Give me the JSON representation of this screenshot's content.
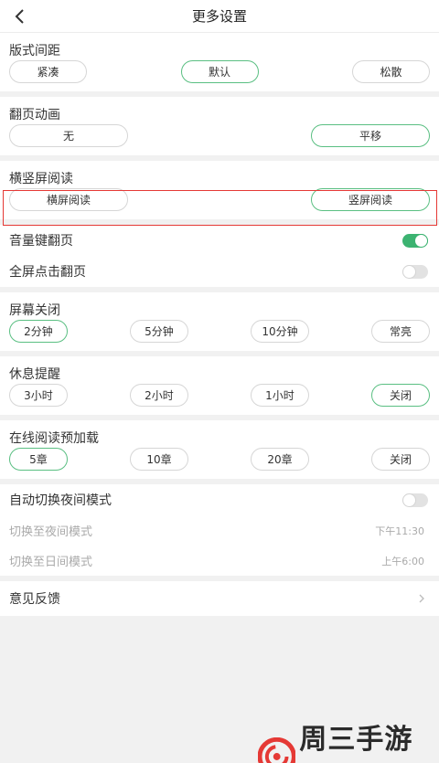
{
  "header": {
    "title": "更多设置",
    "back_icon": "back-arrow-icon"
  },
  "layout_spacing": {
    "title": "版式间距",
    "options": [
      "紧凑",
      "默认",
      "松散"
    ],
    "selected": "默认"
  },
  "page_animation": {
    "title": "翻页动画",
    "options": [
      "无",
      "平移"
    ],
    "selected": "平移"
  },
  "orientation": {
    "title": "横竖屏阅读",
    "options": [
      "横屏阅读",
      "竖屏阅读"
    ],
    "selected": "竖屏阅读"
  },
  "volume_key": {
    "label": "音量键翻页",
    "on": true
  },
  "fullscreen_tap": {
    "label": "全屏点击翻页",
    "on": false
  },
  "screen_off": {
    "title": "屏幕关闭",
    "options": [
      "2分钟",
      "5分钟",
      "10分钟",
      "常亮"
    ],
    "selected": "2分钟"
  },
  "rest_reminder": {
    "title": "休息提醒",
    "options": [
      "3小时",
      "2小时",
      "1小时",
      "关闭"
    ],
    "selected": "关闭"
  },
  "preload": {
    "title": "在线阅读预加载",
    "options": [
      "5章",
      "10章",
      "20章",
      "关闭"
    ],
    "selected": "5章"
  },
  "night_mode": {
    "label": "自动切换夜间模式",
    "on": false,
    "to_night_label": "切换至夜间模式",
    "to_night_time": "下午11:30",
    "to_day_label": "切换至日间模式",
    "to_day_time": "上午6:00"
  },
  "feedback": {
    "label": "意见反馈"
  },
  "watermark": {
    "text": "周三手游网"
  },
  "colors": {
    "accent": "#3cb371",
    "highlight_box": "#e53935"
  }
}
